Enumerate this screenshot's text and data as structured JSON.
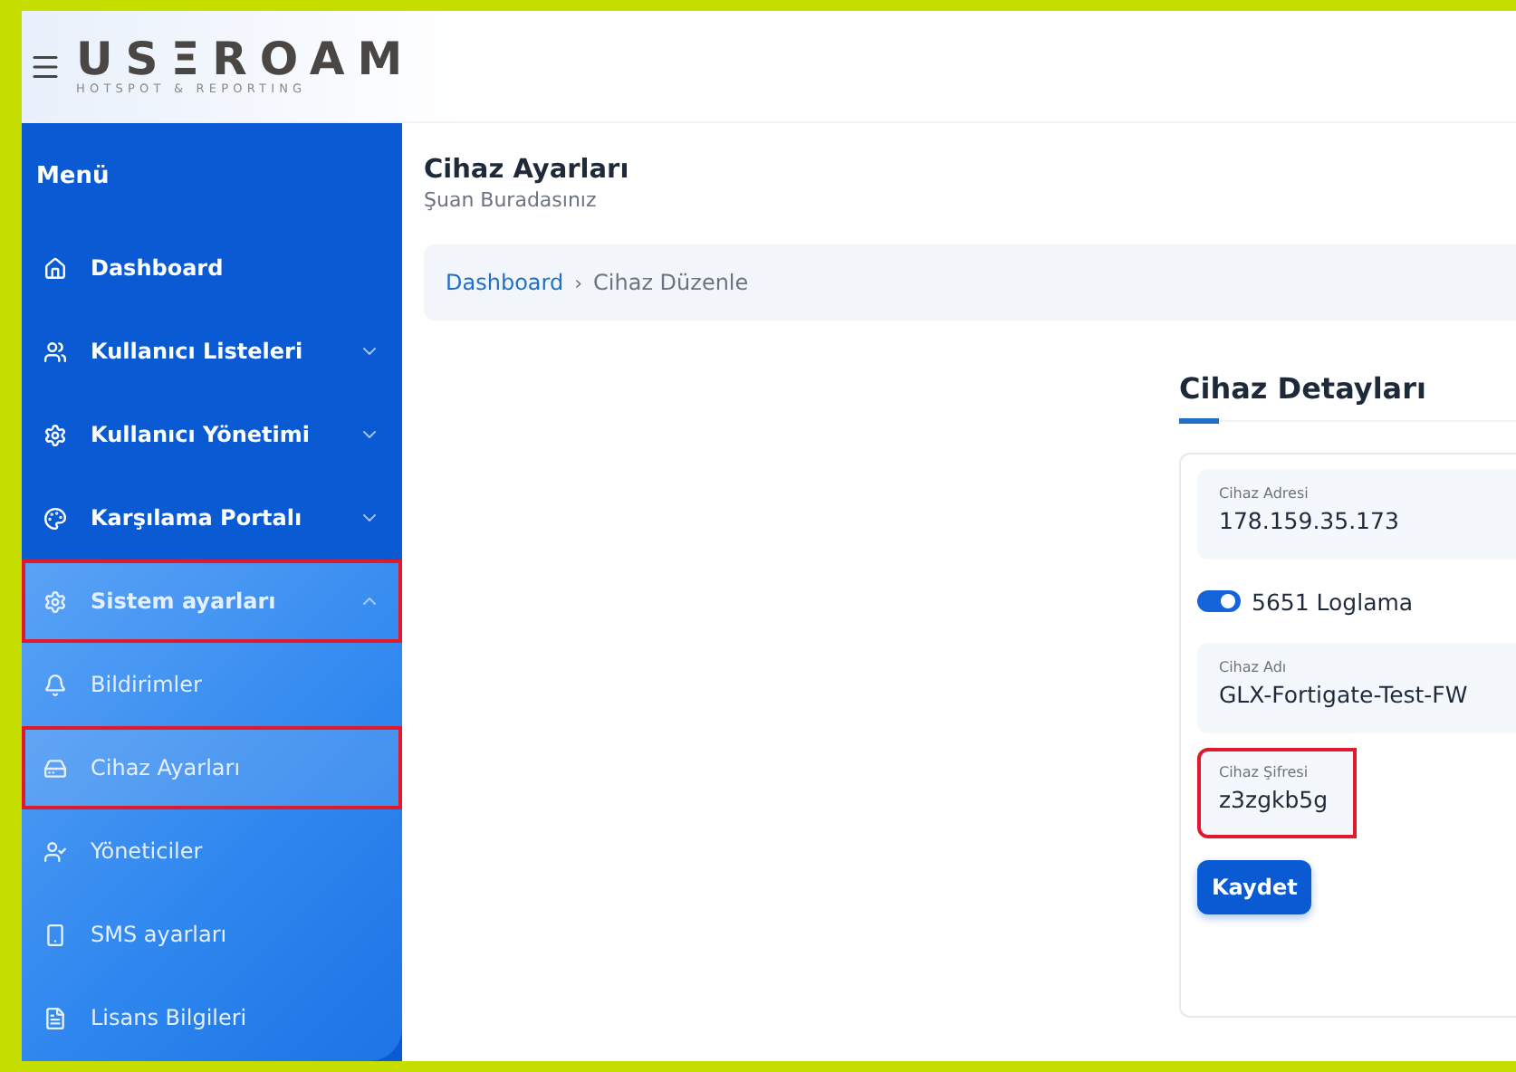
{
  "header": {
    "logo": "USΞROAM",
    "logo_tagline": "HOTSPOT & REPORTING"
  },
  "sidebar": {
    "title": "Menü",
    "items": [
      {
        "kind": "link",
        "label": "Dashboard",
        "selected": false,
        "highlighted": false
      },
      {
        "kind": "group",
        "label": "Kullanıcı Listeleri",
        "expanded": false,
        "selected": false,
        "highlighted": false
      },
      {
        "kind": "group",
        "label": "Kullanıcı Yönetimi",
        "expanded": false,
        "selected": false,
        "highlighted": false
      },
      {
        "kind": "group",
        "label": "Karşılama Portalı",
        "expanded": false,
        "selected": false,
        "highlighted": false
      },
      {
        "kind": "group",
        "label": "Sistem ayarları",
        "expanded": true,
        "selected": false,
        "highlighted": true,
        "children": [
          {
            "label": "Bildirimler",
            "selected": false,
            "highlighted": false
          },
          {
            "label": "Cihaz Ayarları",
            "selected": true,
            "highlighted": true
          },
          {
            "label": "Yöneticiler",
            "selected": false,
            "highlighted": false
          },
          {
            "label": "SMS ayarları",
            "selected": false,
            "highlighted": false
          },
          {
            "label": "Lisans Bilgileri",
            "selected": false,
            "highlighted": false
          }
        ]
      }
    ]
  },
  "page": {
    "title": "Cihaz Ayarları",
    "subtitle": "Şuan Buradasınız"
  },
  "breadcrumb": [
    {
      "label": "Dashboard",
      "kind": "link"
    },
    {
      "label": "›",
      "kind": "separator"
    },
    {
      "label": "Cihaz Düzenle",
      "kind": "current"
    }
  ],
  "card": {
    "title": "Cihaz Detayları",
    "fields": [
      {
        "kind": "text",
        "label": "Cihaz Adresi",
        "value": "178.159.35.173",
        "highlighted": false
      },
      {
        "kind": "toggle",
        "label": "5651 Loglama",
        "on": true
      },
      {
        "kind": "text",
        "label": "Cihaz Adı",
        "value": "GLX-Fortigate-Test-FW",
        "highlighted": false
      },
      {
        "kind": "text",
        "label": "Cihaz Şifresi",
        "value": "z3zgkb5g",
        "highlighted": true
      }
    ],
    "button": "Kaydet"
  }
}
